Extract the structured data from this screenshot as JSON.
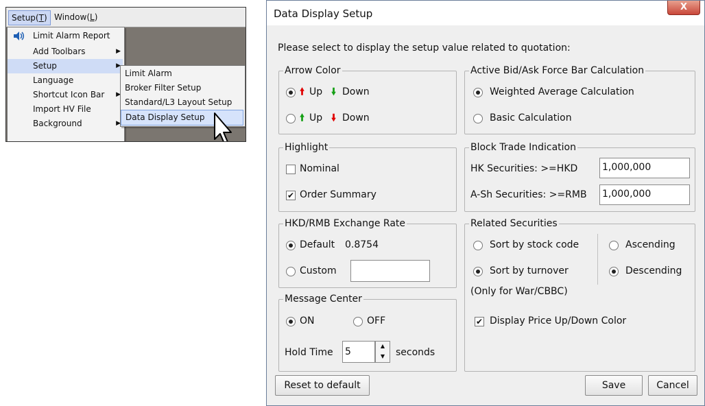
{
  "menubar": {
    "setup_label": "Setup(",
    "setup_key": "T",
    "window_label": "Window(",
    "window_key": "L",
    "close_paren": ")"
  },
  "dropdown": {
    "items": [
      {
        "label": "Limit Alarm Report"
      },
      {
        "label": "Add Toolbars"
      },
      {
        "label": "Setup"
      },
      {
        "label": "Language"
      },
      {
        "label": "Shortcut Icon Bar"
      },
      {
        "label": "Import HV File"
      },
      {
        "label": "Background"
      }
    ]
  },
  "submenu": {
    "items": [
      {
        "label": "Limit Alarm"
      },
      {
        "label": "Broker Filter Setup"
      },
      {
        "label": "Standard/L3 Layout Setup"
      },
      {
        "label": "Data Display Setup"
      }
    ]
  },
  "dialog": {
    "title": "Data Display Setup",
    "close": "X",
    "prompt": "Please select to display the setup value related to quotation:",
    "arrow_color": {
      "label": "Arrow Color",
      "option1_up": "Up",
      "option1_down": "Down",
      "option2_up": "Up",
      "option2_down": "Down",
      "up_glyph": "🠙",
      "down_glyph": "🠛"
    },
    "force_bar": {
      "label": "Active Bid/Ask Force Bar Calculation",
      "weighted": "Weighted Average Calculation",
      "basic": "Basic Calculation"
    },
    "highlight": {
      "label": "Highlight",
      "nominal": "Nominal",
      "order_summary": "Order Summary"
    },
    "block_trade": {
      "label": "Block Trade Indication",
      "hk_label": "HK Securities: >=HKD",
      "hk_value": "1,000,000",
      "ash_label": "A-Sh Securities: >=RMB",
      "ash_value": "1,000,000"
    },
    "exchange": {
      "label": "HKD/RMB Exchange Rate",
      "default": "Default",
      "default_value": "0.8754",
      "custom": "Custom"
    },
    "related": {
      "label": "Related Securities",
      "sort_code": "Sort by stock code",
      "sort_turnover": "Sort by turnover",
      "only_for": "(Only for War/CBBC)",
      "ascending": "Ascending",
      "descending": "Descending",
      "display_color": "Display Price Up/Down Color"
    },
    "message_center": {
      "label": "Message Center",
      "on": "ON",
      "off": "OFF",
      "hold_time": "Hold Time",
      "hold_value": "5",
      "seconds": "seconds"
    },
    "buttons": {
      "reset": "Reset to default",
      "save": "Save",
      "cancel": "Cancel"
    }
  },
  "colors": {
    "up": "#e00000",
    "down_green": "#16a016",
    "highlight": "#cfdcf6",
    "dialog_bg": "#efefef"
  }
}
